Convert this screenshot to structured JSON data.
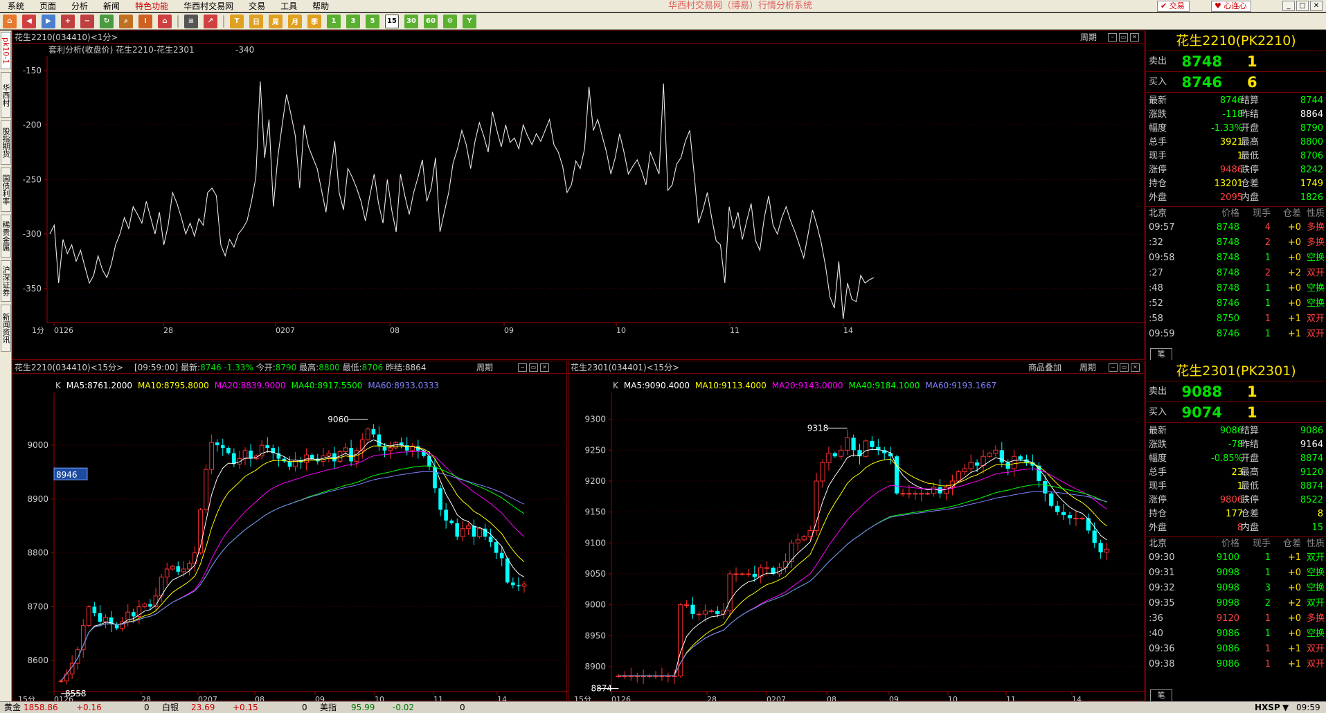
{
  "menu": [
    "系统",
    "页面",
    "分析",
    "新闻",
    "特色功能",
    "华西村交易网",
    "交易",
    "工具",
    "帮助"
  ],
  "menu_highlight_index": 4,
  "app_title": "华西村交易网（博易）行情分析系统",
  "trade_button": "交易",
  "link_button": "心连心",
  "toolbar_icons": [
    "home-icon",
    "back-icon",
    "forward-icon",
    "zoom-in-icon",
    "zoom-out-icon",
    "refresh-icon",
    "search-icon",
    "alert-icon",
    "house-icon",
    "sep",
    "list-icon",
    "chart-icon",
    "sep",
    "period-tick-icon",
    "period-day-icon",
    "period-week-icon",
    "period-month-icon",
    "period-season-icon",
    "period-1min-icon",
    "period-3min-icon",
    "period-5min-icon",
    "period-15min-icon",
    "period-30min-icon",
    "period-60min-icon",
    "period-custom-icon",
    "period-year-icon"
  ],
  "side_tabs": [
    "pk10-1",
    "华西村",
    "股指期货",
    "国债利率",
    "稀贵金属",
    "沪深证券",
    "新闻资讯"
  ],
  "top_pane": {
    "header": "花生2210(034410)<1分>",
    "period_btn": "周期",
    "subtitle": "套利分析(收盘价) 花生2210-花生2301",
    "subtitle_value": "-340",
    "interval_label": "1分",
    "x_labels": [
      "0126",
      "28",
      "0207",
      "08",
      "09",
      "10",
      "11",
      "14"
    ]
  },
  "bl_pane": {
    "header": "花生2210(034410)<15分>",
    "info_time": "[09:59:00]",
    "info": [
      {
        "label": "最新:",
        "value": "8746"
      },
      {
        "label": "",
        "value": "-1.33%"
      },
      {
        "label": "今开:",
        "value": "8790"
      },
      {
        "label": "最高:",
        "value": "8800"
      },
      {
        "label": "最低:",
        "value": "8706"
      },
      {
        "label": "昨结:",
        "value": "8864"
      }
    ],
    "period_btn": "周期",
    "ma_prefix": "K",
    "ma": [
      {
        "text": "MA5:8761.2000",
        "color": "#ffffff"
      },
      {
        "text": "MA10:8795.8000",
        "color": "#ffff00"
      },
      {
        "text": "MA20:8839.9000",
        "color": "#ff00ff"
      },
      {
        "text": "MA40:8917.5500",
        "color": "#00ff00"
      },
      {
        "text": "MA60:8933.0333",
        "color": "#8080ff"
      }
    ],
    "high_label": "9060",
    "low_label": "8558",
    "cursor_value": "8946",
    "interval_label": "15分",
    "x_labels": [
      "0126",
      "28",
      "0207",
      "08",
      "09",
      "10",
      "11",
      "14"
    ]
  },
  "br_pane": {
    "header": "花生2301(034401)<15分>",
    "overlay_btn": "商品叠加",
    "period_btn": "周期",
    "ma_prefix": "K",
    "ma": [
      {
        "text": "MA5:9090.4000",
        "color": "#ffffff"
      },
      {
        "text": "MA10:9113.4000",
        "color": "#ffff00"
      },
      {
        "text": "MA20:9143.0000",
        "color": "#ff00ff"
      },
      {
        "text": "MA40:9184.1000",
        "color": "#00ff00"
      },
      {
        "text": "MA60:9193.1667",
        "color": "#8080ff"
      }
    ],
    "high_label": "9318",
    "low_label": "8874",
    "interval_label": "15分",
    "x_labels": [
      "0126",
      "28",
      "0207",
      "08",
      "09",
      "10",
      "11",
      "14"
    ]
  },
  "quote_top": {
    "title": "花生2210(PK2210)",
    "sell_label": "卖出",
    "sell_price": "8748",
    "sell_qty": "1",
    "buy_label": "买入",
    "buy_price": "8746",
    "buy_qty": "6",
    "stats": [
      [
        "最新",
        "8746",
        "#00ff00",
        "结算",
        "8744",
        "#00ff00"
      ],
      [
        "涨跌",
        "-118",
        "#00ff00",
        "昨结",
        "8864",
        "#ffffff"
      ],
      [
        "幅度",
        "-1.33%",
        "#00ff00",
        "开盘",
        "8790",
        "#00ff00"
      ],
      [
        "总手",
        "3921",
        "#ffff00",
        "最高",
        "8800",
        "#00ff00"
      ],
      [
        "现手",
        "1",
        "#ffff00",
        "最低",
        "8706",
        "#00ff00"
      ],
      [
        "涨停",
        "9486",
        "#ff4040",
        "跌停",
        "8242",
        "#00ff00"
      ],
      [
        "持仓",
        "13201",
        "#ffff00",
        "仓差",
        "1749",
        "#ffff00"
      ],
      [
        "外盘",
        "2095",
        "#ff4040",
        "内盘",
        "1826",
        "#00ff00"
      ]
    ],
    "ticks_header": [
      "北京",
      "价格",
      "现手",
      "仓差",
      "性质"
    ],
    "ticks": [
      [
        "09:57",
        "8748",
        "4",
        "+0",
        "多换",
        "#00ff00",
        "#ff4040",
        "#ff4040"
      ],
      [
        ":32",
        "8748",
        "2",
        "+0",
        "多换",
        "#00ff00",
        "#ff4040",
        "#ff4040"
      ],
      [
        "09:58",
        "8748",
        "1",
        "+0",
        "空换",
        "#00ff00",
        "#00ff00",
        "#00ff00"
      ],
      [
        ":27",
        "8748",
        "2",
        "+2",
        "双开",
        "#00ff00",
        "#ff4040",
        "#ff4040"
      ],
      [
        ":48",
        "8748",
        "1",
        "+0",
        "空换",
        "#00ff00",
        "#00ff00",
        "#00ff00"
      ],
      [
        ":52",
        "8746",
        "1",
        "+0",
        "空换",
        "#00ff00",
        "#00ff00",
        "#00ff00"
      ],
      [
        ":58",
        "8750",
        "1",
        "+1",
        "双开",
        "#00ff00",
        "#ff4040",
        "#ff4040"
      ],
      [
        "09:59",
        "8746",
        "1",
        "+1",
        "双开",
        "#00ff00",
        "#00ff00",
        "#ff4040"
      ]
    ],
    "foot_tab": "笔"
  },
  "quote_bottom": {
    "title": "花生2301(PK2301)",
    "sell_label": "卖出",
    "sell_price": "9088",
    "sell_qty": "1",
    "buy_label": "买入",
    "buy_price": "9074",
    "buy_qty": "1",
    "stats": [
      [
        "最新",
        "9086",
        "#00ff00",
        "结算",
        "9086",
        "#00ff00"
      ],
      [
        "涨跌",
        "-78",
        "#00ff00",
        "昨结",
        "9164",
        "#ffffff"
      ],
      [
        "幅度",
        "-0.85%",
        "#00ff00",
        "开盘",
        "8874",
        "#00ff00"
      ],
      [
        "总手",
        "23",
        "#ffff00",
        "最高",
        "9120",
        "#00ff00"
      ],
      [
        "现手",
        "1",
        "#ffff00",
        "最低",
        "8874",
        "#00ff00"
      ],
      [
        "涨停",
        "9806",
        "#ff4040",
        "跌停",
        "8522",
        "#00ff00"
      ],
      [
        "持仓",
        "177",
        "#ffff00",
        "仓差",
        "8",
        "#ffff00"
      ],
      [
        "外盘",
        "8",
        "#ff4040",
        "内盘",
        "15",
        "#00ff00"
      ]
    ],
    "ticks_header": [
      "北京",
      "价格",
      "现手",
      "仓差",
      "性质"
    ],
    "ticks": [
      [
        "09:30",
        "9100",
        "1",
        "+1",
        "双开",
        "#00ff00",
        "#00ff00",
        "#00ff00"
      ],
      [
        "09:31",
        "9098",
        "1",
        "+0",
        "空换",
        "#00ff00",
        "#00ff00",
        "#00ff00"
      ],
      [
        "09:32",
        "9098",
        "3",
        "+0",
        "空换",
        "#00ff00",
        "#00ff00",
        "#00ff00"
      ],
      [
        "09:35",
        "9098",
        "2",
        "+2",
        "双开",
        "#00ff00",
        "#00ff00",
        "#00ff00"
      ],
      [
        ":36",
        "9120",
        "1",
        "+0",
        "多换",
        "#ff4040",
        "#ff4040",
        "#ff4040"
      ],
      [
        ":40",
        "9086",
        "1",
        "+0",
        "空换",
        "#00ff00",
        "#00ff00",
        "#00ff00"
      ],
      [
        "09:36",
        "9086",
        "1",
        "+1",
        "双开",
        "#00ff00",
        "#ff4040",
        "#ff4040"
      ],
      [
        "09:38",
        "9086",
        "1",
        "+1",
        "双开",
        "#00ff00",
        "#ff4040",
        "#ff4040"
      ]
    ],
    "foot_tab": "笔"
  },
  "status": {
    "gold_label": "黄金",
    "gold_price": "1858.86",
    "gold_chg": "+0.16",
    "gold_vol": "0",
    "silver_label": "白银",
    "silver_price": "23.69",
    "silver_chg": "+0.15",
    "silver_vol": "0",
    "usd_label": "美指",
    "usd_price": "95.99",
    "usd_chg": "-0.02",
    "usd_vol": "0",
    "brand": "HXSP",
    "clock": "09:59"
  },
  "chart_data": [
    {
      "type": "line",
      "title": "套利分析(收盘价) 花生2210-花生2301",
      "series": [
        {
          "name": "",
          "values": [
            -300,
            -292,
            -345,
            -305,
            -318,
            -310,
            -325,
            -315,
            -330,
            -345,
            -338,
            -320,
            -333,
            -340,
            -328,
            -310,
            -300,
            -285,
            -295,
            -275,
            -282,
            -290,
            -270,
            -285,
            -300,
            -280,
            -310,
            -292,
            -262,
            -272,
            -285,
            -300,
            -290,
            -302,
            -286,
            -292,
            -262,
            -258,
            -265,
            -310,
            -320,
            -305,
            -312,
            -300,
            -295,
            -288,
            -270,
            -248,
            -160,
            -230,
            -195,
            -275,
            -230,
            -200,
            -172,
            -190,
            -210,
            -258,
            -200,
            -220,
            -230,
            -240,
            -260,
            -280,
            -245,
            -215,
            -262,
            -278,
            -240,
            -248,
            -258,
            -270,
            -288,
            -265,
            -245,
            -272,
            -290,
            -250,
            -278,
            -298,
            -245,
            -265,
            -282,
            -262,
            -248,
            -232,
            -270,
            -258,
            -230,
            -298,
            -280,
            -262,
            -235,
            -222,
            -205,
            -218,
            -240,
            -215,
            -198,
            -210,
            -225,
            -188,
            -205,
            -220,
            -200,
            -216,
            -212,
            -222,
            -200,
            -210,
            -218,
            -208,
            -215,
            -205,
            -195,
            -218,
            -225,
            -238,
            -262,
            -255,
            -233,
            -240,
            -222,
            -165,
            -205,
            -195,
            -210,
            -225,
            -245,
            -230,
            -208,
            -225,
            -245,
            -238,
            -232,
            -242,
            -255,
            -225,
            -235,
            -245,
            -162,
            -260,
            -255,
            -236,
            -230,
            -215,
            -205,
            -245,
            -290,
            -278,
            -262,
            -285,
            -306,
            -310,
            -345,
            -275,
            -295,
            -280,
            -305,
            -288,
            -272,
            -306,
            -315,
            -285,
            -265,
            -292,
            -300,
            -285,
            -275,
            -288,
            -298,
            -310,
            -322,
            -300,
            -278,
            -292,
            -308,
            -330,
            -358,
            -368,
            -325,
            -378,
            -345,
            -360,
            -362,
            -338,
            -345,
            -342,
            -340
          ]
        }
      ],
      "xlabel": "",
      "ylabel": "",
      "ylim": [
        -380,
        -140
      ],
      "y_ticks": [
        -150,
        -200,
        -250,
        -300,
        -350
      ],
      "x_ticks": [
        "0126",
        "28",
        "0207",
        "08",
        "09",
        "10",
        "11",
        "14"
      ]
    },
    {
      "type": "candlestick",
      "title": "花生2210(034410)<15分>",
      "ylim": [
        8545,
        9085
      ],
      "y_ticks": [
        8600,
        8700,
        8800,
        8900,
        9000
      ],
      "x_ticks": [
        "0126",
        "28",
        "0207",
        "08",
        "09",
        "10",
        "11",
        "14"
      ],
      "closes": [
        8562,
        8575,
        8595,
        8620,
        8665,
        8700,
        8688,
        8672,
        8680,
        8668,
        8660,
        8672,
        8690,
        8682,
        8700,
        8705,
        8700,
        8720,
        8755,
        8770,
        8775,
        8765,
        8770,
        8780,
        8800,
        8880,
        8955,
        9005,
        9000,
        8995,
        8985,
        8965,
        8975,
        8990,
        8975,
        8980,
        9000,
        8995,
        8985,
        8975,
        8970,
        8960,
        8972,
        8968,
        8982,
        8975,
        8970,
        8980,
        8985,
        8970,
        8988,
        8995,
        8970,
        8990,
        9010,
        9030,
        9020,
        8998,
        8990,
        8995,
        9005,
        9000,
        8990,
        8998,
        8990,
        8980,
        8960,
        8920,
        8880,
        8860,
        8855,
        8830,
        8845,
        8850,
        8830,
        8845,
        8830,
        8820,
        8800,
        8790,
        8745,
        8740,
        8738,
        8742
      ],
      "ma_colors": [
        "#ffffff",
        "#ffff00",
        "#ff00ff",
        "#00ff00",
        "#8080ff"
      ]
    },
    {
      "type": "candlestick",
      "title": "花生2301(034401)<15分>",
      "ylim": [
        8862,
        9332
      ],
      "y_ticks": [
        8900,
        8950,
        9000,
        9050,
        9100,
        9150,
        9200,
        9250,
        9300
      ],
      "x_ticks": [
        "0126",
        "28",
        "0207",
        "08",
        "09",
        "10",
        "11",
        "14"
      ],
      "closes": [
        8885,
        8885,
        8885,
        8885,
        8885,
        8885,
        8885,
        8885,
        8885,
        8885,
        9000,
        9000,
        8985,
        8985,
        8990,
        8990,
        8985,
        8990,
        9050,
        9050,
        9050,
        9050,
        9045,
        9060,
        9060,
        9050,
        9060,
        9070,
        9100,
        9105,
        9110,
        9120,
        9200,
        9230,
        9245,
        9240,
        9250,
        9270,
        9250,
        9240,
        9265,
        9255,
        9250,
        9245,
        9240,
        9180,
        9180,
        9180,
        9180,
        9180,
        9180,
        9190,
        9180,
        9190,
        9200,
        9215,
        9220,
        9230,
        9225,
        9240,
        9245,
        9250,
        9230,
        9220,
        9240,
        9235,
        9230,
        9225,
        9200,
        9180,
        9160,
        9150,
        9145,
        9140,
        9140,
        9140,
        9120,
        9100,
        9085,
        9090
      ]
    }
  ]
}
